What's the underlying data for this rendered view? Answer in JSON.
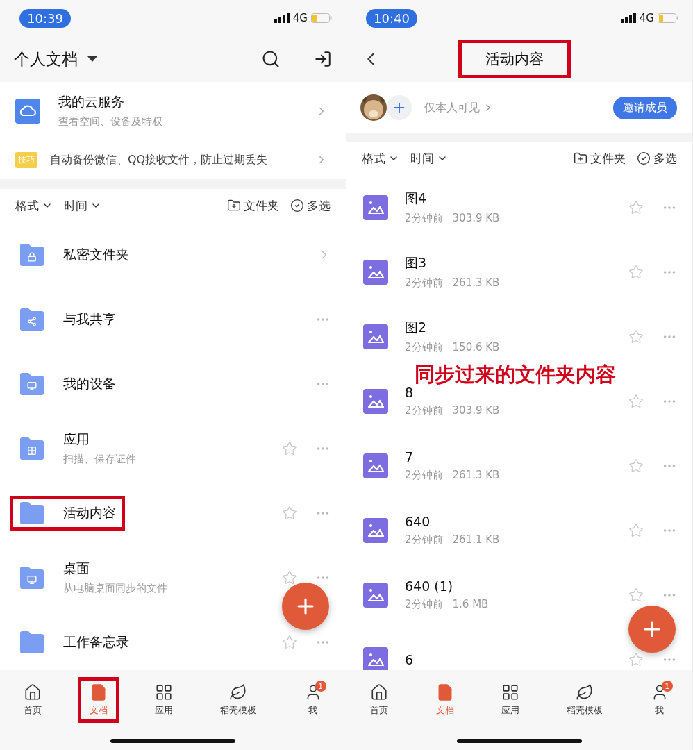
{
  "left_screen": {
    "status_bar": {
      "time": "10:39",
      "network": "4G"
    },
    "header": {
      "title": "个人文档"
    },
    "cloud_card": {
      "title": "我的云服务",
      "subtitle": "查看空间、设备及特权"
    },
    "tip": {
      "badge": "技巧",
      "text": "自动备份微信、QQ接收文件，防止过期丢失"
    },
    "toolbar": {
      "filters": [
        "格式",
        "时间"
      ],
      "actions": [
        {
          "kind": "folder",
          "label": "文件夹"
        },
        {
          "kind": "multi",
          "label": "多选"
        }
      ]
    },
    "rows": [
      {
        "kind": "lock",
        "name": "私密文件夹",
        "highlighted": false
      },
      {
        "kind": "share",
        "name": "与我共享",
        "highlighted": false
      },
      {
        "kind": "device",
        "name": "我的设备",
        "highlighted": false
      },
      {
        "kind": "apps",
        "name": "应用",
        "subtitle": "扫描、保存证件",
        "starred": false,
        "highlighted": false
      },
      {
        "kind": "plain",
        "name": "活动内容",
        "starred": false,
        "highlighted": true
      },
      {
        "kind": "desktop",
        "name": "桌面",
        "subtitle": "从电脑桌面同步的文件",
        "starred": false,
        "highlighted": false
      },
      {
        "kind": "plain",
        "name": "工作备忘录",
        "starred": false,
        "highlighted": false
      }
    ],
    "tabs": [
      {
        "kind": "home",
        "label": "首页",
        "selected": false,
        "highlighted": false
      },
      {
        "kind": "doc",
        "label": "文档",
        "selected": true,
        "highlighted": true
      },
      {
        "kind": "grid",
        "label": "应用",
        "selected": false,
        "highlighted": false
      },
      {
        "kind": "leaf",
        "label": "稻壳模板",
        "selected": false,
        "highlighted": false
      },
      {
        "kind": "user",
        "label": "我",
        "selected": false,
        "highlighted": false,
        "badge": "1"
      }
    ]
  },
  "right_screen": {
    "status_bar": {
      "time": "10:40",
      "network": "4G"
    },
    "header": {
      "title": "活动内容",
      "highlighted": true
    },
    "members": {
      "visibility": "仅本人可见",
      "invite": "邀请成员"
    },
    "toolbar": {
      "filters": [
        "格式",
        "时间"
      ],
      "actions": [
        {
          "kind": "folder",
          "label": "文件夹"
        },
        {
          "kind": "multi",
          "label": "多选"
        }
      ]
    },
    "files": [
      {
        "name": "图4",
        "time": "2分钟前",
        "size": "303.9 KB",
        "starred": false
      },
      {
        "name": "图3",
        "time": "2分钟前",
        "size": "261.3 KB",
        "starred": false
      },
      {
        "name": "图2",
        "time": "2分钟前",
        "size": "150.6 KB",
        "starred": false
      },
      {
        "name": "8",
        "time": "2分钟前",
        "size": "303.9 KB",
        "starred": false
      },
      {
        "name": "7",
        "time": "2分钟前",
        "size": "261.3 KB",
        "starred": false
      },
      {
        "name": "640",
        "time": "2分钟前",
        "size": "261.1 KB",
        "starred": false
      },
      {
        "name": "640 (1)",
        "time": "2分钟前",
        "size": "1.6 MB",
        "starred": false
      },
      {
        "name": "6",
        "starred": false
      }
    ],
    "caption": "同步过来的文件夹内容",
    "tabs": [
      {
        "kind": "home",
        "label": "首页",
        "selected": false,
        "highlighted": false
      },
      {
        "kind": "doc",
        "label": "文档",
        "selected": true,
        "highlighted": false
      },
      {
        "kind": "grid",
        "label": "应用",
        "selected": false,
        "highlighted": false
      },
      {
        "kind": "leaf",
        "label": "稻壳模板",
        "selected": false,
        "highlighted": false
      },
      {
        "kind": "user",
        "label": "我",
        "selected": false,
        "highlighted": false,
        "badge": "1"
      }
    ]
  }
}
